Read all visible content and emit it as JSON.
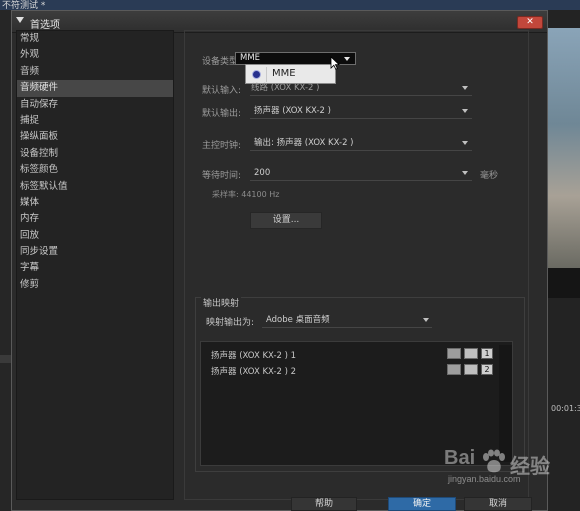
{
  "background_app": {
    "title_fragment": "不符测试 *",
    "timecode": "00:01:3"
  },
  "dialog": {
    "title": "首选项",
    "close_label": "✕"
  },
  "sidebar": {
    "items": [
      {
        "label": "常规"
      },
      {
        "label": "外观"
      },
      {
        "label": "音频"
      },
      {
        "label": "音频硬件",
        "active": true
      },
      {
        "label": "自动保存"
      },
      {
        "label": "捕捉"
      },
      {
        "label": "操纵面板"
      },
      {
        "label": "设备控制"
      },
      {
        "label": "标签颜色"
      },
      {
        "label": "标签默认值"
      },
      {
        "label": "媒体"
      },
      {
        "label": "内存"
      },
      {
        "label": "回放"
      },
      {
        "label": "同步设置"
      },
      {
        "label": "字幕"
      },
      {
        "label": "修剪"
      }
    ]
  },
  "audio_hardware": {
    "device_type_label": "设备类型:",
    "device_type_value": "MME",
    "device_type_dropdown_option": "MME",
    "default_input_label": "默认输入:",
    "default_input_value": "线路 (XOX KX-2 )",
    "default_output_label": "默认输出:",
    "default_output_value": "扬声器 (XOX KX-2 )",
    "master_clock_label": "主控时钟:",
    "master_clock_value": "输出: 扬声器 (XOX KX-2 )",
    "latency_label": "等待时间:",
    "latency_value": "200",
    "latency_unit": "毫秒",
    "sample_rate_label": "采样率: 44100 Hz",
    "settings_button": "设置..."
  },
  "output_mapping": {
    "group_title": "输出映射",
    "map_to_label": "映射输出为:",
    "map_to_value": "Adobe 桌面音频",
    "rows": [
      {
        "label": "扬声器 (XOX KX-2 ) 1",
        "channel": "1"
      },
      {
        "label": "扬声器 (XOX KX-2 ) 2",
        "channel": "2"
      }
    ]
  },
  "buttons": {
    "help": "帮助",
    "ok": "确定",
    "cancel": "取消"
  },
  "watermark": {
    "brand": "Bai",
    "brand_suffix": "经验",
    "url": "jingyan.baidu.com"
  },
  "colors": {
    "ok_button": "#2e6aa6",
    "close_button": "#c2473b",
    "selected_item": "#474747"
  }
}
